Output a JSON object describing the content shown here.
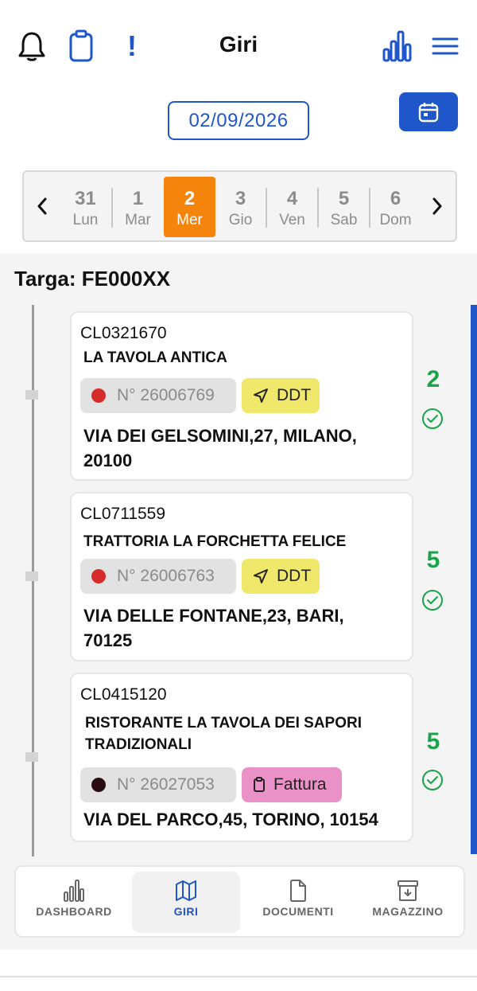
{
  "header": {
    "title": "Giri",
    "alert_glyph": "!",
    "icons": [
      "bell-icon",
      "clipboard-icon",
      "exclamation-icon",
      "bar-chart-icon",
      "hamburger-menu-icon"
    ]
  },
  "date": {
    "value": "02/09/2026"
  },
  "week": {
    "days": [
      {
        "num": "31",
        "name": "Lun"
      },
      {
        "num": "1",
        "name": "Mar"
      },
      {
        "num": "2",
        "name": "Mer",
        "active": true
      },
      {
        "num": "3",
        "name": "Gio"
      },
      {
        "num": "4",
        "name": "Ven"
      },
      {
        "num": "5",
        "name": "Sab"
      },
      {
        "num": "6",
        "name": "Dom"
      }
    ]
  },
  "targa": {
    "text": "Targa: FE000XX"
  },
  "stops": [
    {
      "code": "CL0321670",
      "name": "LA TAVOLA ANTICA",
      "doc_number": "N° 26006769",
      "status_color": "#d62b2b",
      "doc_type": "DDT",
      "doc_color": "#f0e86b",
      "address": "VIA DEI GELSOMINI,27, MILANO, 20100",
      "count": "2"
    },
    {
      "code": "CL0711559",
      "name": "TRATTORIA LA FORCHETTA FELICE",
      "doc_number": "N° 26006763",
      "status_color": "#d62b2b",
      "doc_type": "DDT",
      "doc_color": "#f0e86b",
      "address": "VIA DELLE FONTANE,23, BARI, 70125",
      "count": "5"
    },
    {
      "code": "CL0415120",
      "name": "RISTORANTE LA TAVOLA DEI SAPORI TRADIZIONALI",
      "doc_number": "N° 26027053",
      "status_color": "#2a0c12",
      "doc_type": "Fattura",
      "doc_color": "#ea92c8",
      "address": "VIA DEL PARCO,45, TORINO, 10154",
      "count": "5"
    }
  ],
  "nav": {
    "items": [
      {
        "label": "DASHBOARD",
        "icon": "bar-chart-icon"
      },
      {
        "label": "GIRI",
        "icon": "map-icon",
        "active": true
      },
      {
        "label": "DOCUMENTI",
        "icon": "document-icon"
      },
      {
        "label": "MAGAZZINO",
        "icon": "archive-icon"
      }
    ]
  },
  "colors": {
    "accent": "#1f56c9",
    "active_day": "#f5840c",
    "ok_green": "#1aa34a"
  }
}
